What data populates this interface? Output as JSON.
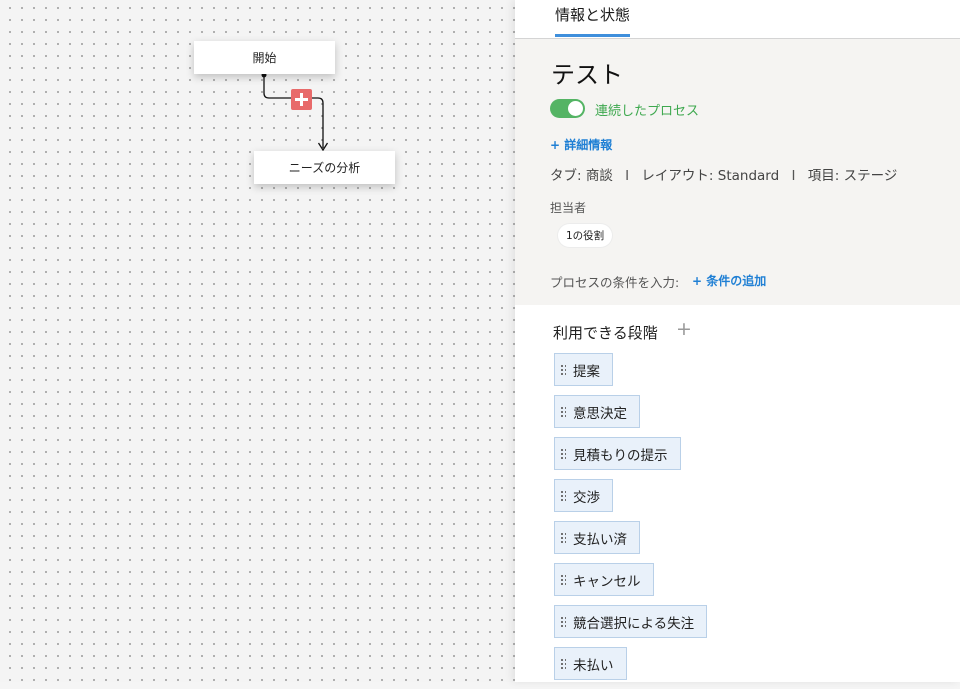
{
  "canvas": {
    "nodes": {
      "start": "開始",
      "needs_analysis": "ニーズの分析"
    },
    "add_step_icon": "plus-icon",
    "accent_color": "#e86a6a"
  },
  "panel": {
    "tab_label": "情報と状態",
    "process_title": "テスト",
    "toggle_label": "連続したプロセス",
    "toggle_on": true,
    "more_info_link": "+ 詳細情報",
    "meta": {
      "tab": "タブ: 商談",
      "separator": "I",
      "layout": "レイアウト: Standard",
      "field": "項目: ステージ"
    },
    "owner_label": "担当者",
    "role_pill": "1の役割",
    "condition_label": "プロセスの条件を入力:",
    "condition_add_link": "+ 条件の追加",
    "stages_header": "利用できる段階",
    "stages_add_icon": "+",
    "stages": [
      "提案",
      "意思決定",
      "見積もりの提示",
      "交渉",
      "支払い済",
      "キャンセル",
      "競合選択による失注",
      "未払い"
    ],
    "colors": {
      "link": "#1f7fd4",
      "toggle_on": "#54b464",
      "tab_underline": "#3f8fdc"
    }
  }
}
